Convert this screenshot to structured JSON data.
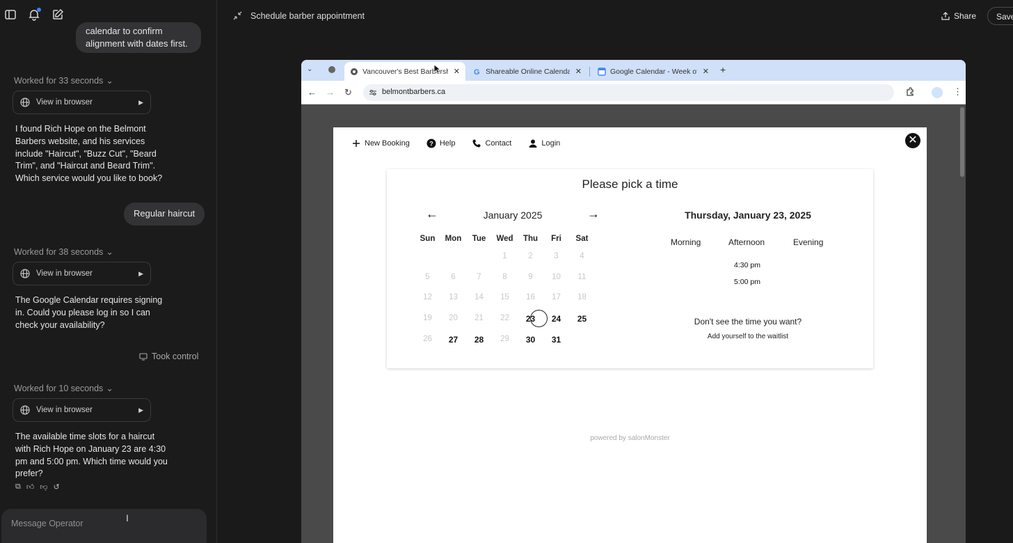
{
  "chat": {
    "bubble1": [
      "calendar to confirm",
      "alignment with dates first."
    ],
    "worked1": "Worked for 33 seconds",
    "view_in_browser": "View in browser",
    "msg1": "I found Rich Hope on the Belmont Barbers website, and his services include \"Haircut\", \"Buzz Cut\", \"Beard Trim\", and \"Haircut and Beard Trim\". Which service would you like to book?",
    "user_reply": "Regular haircut",
    "worked2": "Worked for 38 seconds",
    "msg2": "The Google Calendar requires signing in. Could you please log in so I can check your availability?",
    "took_control": "Took control",
    "worked3": "Worked for 10 seconds",
    "msg3": "The available time slots for a haircut with Rich Hope on January 23 are 4:30 pm and 5:00 pm. Which time would you prefer?",
    "composer_placeholder": "Message Operator"
  },
  "header": {
    "title": "Schedule barber appointment",
    "share": "Share",
    "save": "Save"
  },
  "browser": {
    "tabs": [
      {
        "label": "Vancouver's Best Barbersho",
        "active": true
      },
      {
        "label": "Shareable Online Calendar a",
        "active": false
      },
      {
        "label": "Google Calendar - Week of J",
        "active": false
      }
    ],
    "url": "belmontbarbers.ca"
  },
  "booking": {
    "nav": [
      "New Booking",
      "Help",
      "Contact",
      "Login"
    ],
    "title": "Please pick a time",
    "month": "January 2025",
    "weekdays": [
      "Sun",
      "Mon",
      "Tue",
      "Wed",
      "Thu",
      "Fri",
      "Sat"
    ],
    "days": [
      [
        null,
        null,
        null,
        "1",
        "2",
        "3",
        "4"
      ],
      [
        "5",
        "6",
        "7",
        "8",
        "9",
        "10",
        "11"
      ],
      [
        "12",
        "13",
        "14",
        "15",
        "16",
        "17",
        "18"
      ],
      [
        "19",
        "20",
        "21",
        "22",
        "23",
        "24",
        "25"
      ],
      [
        "26",
        "27",
        "28",
        "29",
        "30",
        "31",
        null
      ]
    ],
    "available_days": [
      "23",
      "24",
      "25",
      "27",
      "28",
      "30",
      "31"
    ],
    "selected_day": "23",
    "selected_date": "Thursday, January 23, 2025",
    "periods": [
      "Morning",
      "Afternoon",
      "Evening"
    ],
    "slots": [
      "4:30 pm",
      "5:00 pm"
    ],
    "no_time": "Don't see the time you want?",
    "waitlist": "Add yourself to the waitlist",
    "powered": "powered by salonMonster"
  }
}
